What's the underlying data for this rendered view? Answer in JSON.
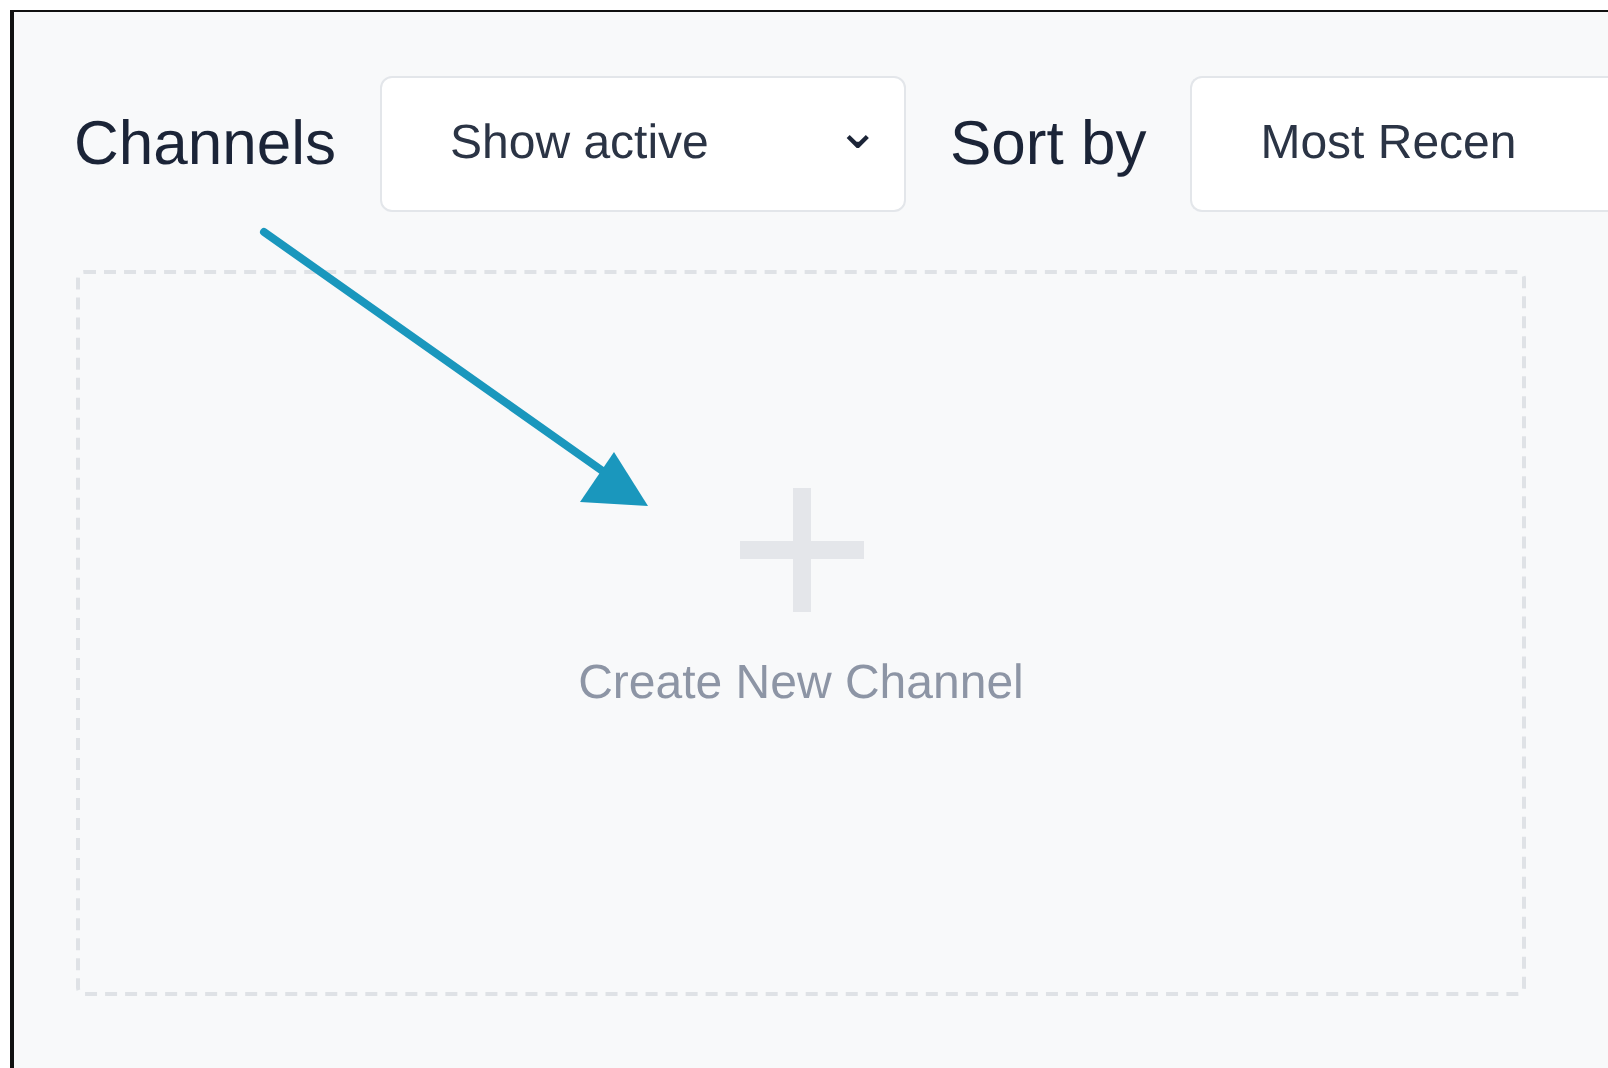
{
  "header": {
    "title": "Channels",
    "filter": {
      "label": "Show active",
      "caret": "⌄"
    },
    "sort_label": "Sort by",
    "sort": {
      "label": "Most Recen"
    }
  },
  "create_card": {
    "label": "Create New Channel"
  },
  "annotation": {
    "kind": "arrow"
  }
}
